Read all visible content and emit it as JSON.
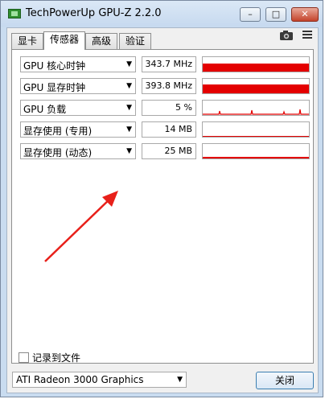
{
  "window": {
    "title": "TechPowerUp GPU-Z 2.2.0",
    "min_glyph": "–",
    "max_glyph": "□",
    "close_glyph": "✕"
  },
  "tabs": [
    {
      "label": "显卡"
    },
    {
      "label": "传感器"
    },
    {
      "label": "高级"
    },
    {
      "label": "验证"
    }
  ],
  "active_tab": "传感器",
  "icons": {
    "camera": "camera-icon",
    "menu": "hamburger-menu-icon"
  },
  "sensors": [
    {
      "label": "GPU 核心时钟",
      "value": "343.7 MHz",
      "level": 0.55
    },
    {
      "label": "GPU 显存时钟",
      "value": "393.8 MHz",
      "level": 0.6
    },
    {
      "label": "GPU 负载",
      "value": "5 %",
      "level": 0.05
    },
    {
      "label": "显存使用 (专用)",
      "value": "14 MB",
      "level": 0.02
    },
    {
      "label": "显存使用 (动态)",
      "value": "25 MB",
      "level": 0.03
    }
  ],
  "log_to_file_label": "记录到文件",
  "gpu_select": {
    "value": "ATI Radeon 3000 Graphics"
  },
  "close_button_label": "关闭",
  "colors": {
    "graph": "#e40000",
    "annotation_arrow": "#e8201a"
  }
}
